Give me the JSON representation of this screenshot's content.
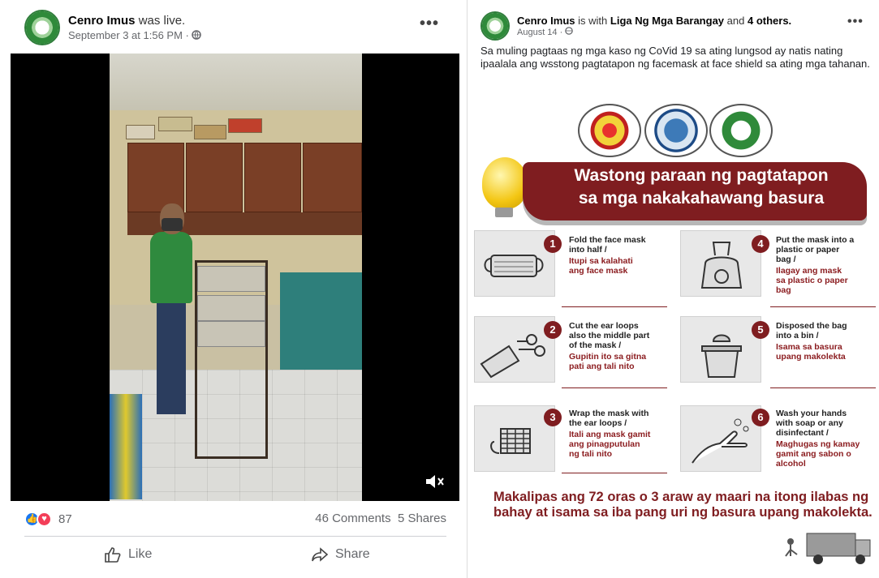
{
  "left_post": {
    "page_name": "Cenro Imus",
    "action_text": "was live.",
    "date": "September 3 at 1:56 PM ·",
    "privacy_icon": "globe-icon",
    "more_icon": "ellipsis-icon",
    "reaction_count": "87",
    "comments": "46 Comments",
    "shares": "5 Shares",
    "like_label": "Like",
    "share_label": "Share",
    "video_icon": "mute-icon"
  },
  "right_post": {
    "page_name": "Cenro Imus",
    "with_text": "is with",
    "tagged": "Liga Ng Mga Barangay",
    "and_text": "and",
    "others": "4 others.",
    "date": "August 14 ·",
    "caption": "Sa muling pagtaas ng mga kaso ng CoVid 19 sa ating lungsod ay natis nating ipaalala ang wsstong pagtatapon ng facemask at face shield sa ating mga tahanan.",
    "poster": {
      "title_line1": "Wastong paraan ng pagtatapon",
      "title_line2": "sa mga nakakahawang basura",
      "steps": [
        {
          "num": "1",
          "en": "Fold the face mask\ninto half /",
          "tl": "Itupi sa kalahati\nang face mask",
          "icon": "folded-mask-icon"
        },
        {
          "num": "2",
          "en": "Cut the ear loops\nalso the middle part\nof the mask /",
          "tl": "Gupitin ito sa gitna\npati ang tali nito",
          "icon": "scissors-mask-icon"
        },
        {
          "num": "3",
          "en": "Wrap the mask  with\nthe ear loops /",
          "tl": "Itali ang mask gamit\nang pinagputulan\nng tali nito",
          "icon": "wrapped-mask-icon"
        },
        {
          "num": "4",
          "en": "Put the mask into a\nplastic or paper\nbag /",
          "tl": "Ilagay ang mask\nsa plastic o paper\nbag",
          "icon": "biohazard-bag-icon"
        },
        {
          "num": "5",
          "en": "Disposed the bag\ninto a bin /",
          "tl": "Isama sa basura\nupang makolekta",
          "icon": "trash-bin-icon"
        },
        {
          "num": "6",
          "en": "Wash your hands\nwith soap or any\ndisinfectant /",
          "tl": "Maghugas ng kamay\ngamit ang sabon o\nalcohol",
          "icon": "hand-wash-icon"
        }
      ],
      "footer": "Makalipas ang 72 oras o  3 araw ay maari na  itong ilabas ng bahay at isama sa iba pang uri ng basura upang makolekta."
    }
  },
  "colors": {
    "accent_red": "#7f1d20",
    "fb_blue": "#1877f2",
    "gray_text": "#65676b"
  }
}
